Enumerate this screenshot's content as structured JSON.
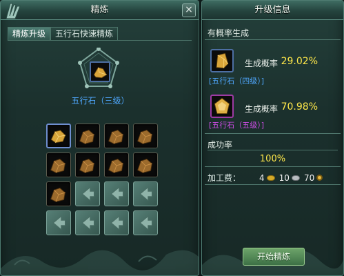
{
  "left_panel": {
    "title": "精炼",
    "close_symbol": "×",
    "tabs": [
      {
        "label": "精炼升级",
        "active": true
      },
      {
        "label": "五行石快速精炼",
        "active": false
      }
    ],
    "target_item_label": "五行石（三级）",
    "grid": {
      "rows": [
        [
          "full-selected",
          "full",
          "full",
          "full"
        ],
        [
          "full",
          "full",
          "full",
          "full"
        ],
        [
          "full",
          "empty",
          "empty",
          "empty"
        ],
        [
          "empty",
          "empty",
          "empty",
          "empty"
        ]
      ]
    }
  },
  "right_panel": {
    "title": "升级信息",
    "possible_results_label": "有概率生成",
    "results": [
      {
        "item_name": "[五行石（四级）]",
        "rate_label": "生成概率",
        "rate_value": "29.02%",
        "quality_color": "#4fa8ff"
      },
      {
        "item_name": "[五行石（五级）]",
        "rate_label": "生成概率",
        "rate_value": "70.98%",
        "quality_color": "#d04de8"
      }
    ],
    "success_label": "成功率",
    "success_value": "100%",
    "fee": {
      "label": "加工费：",
      "gold": "4",
      "silver": "10",
      "copper": "70"
    },
    "start_button_label": "开始精炼"
  },
  "colors": {
    "value_yellow": "#ffe84a",
    "blue_quality": "#4fa8ff",
    "purple_quality": "#d04de8"
  }
}
